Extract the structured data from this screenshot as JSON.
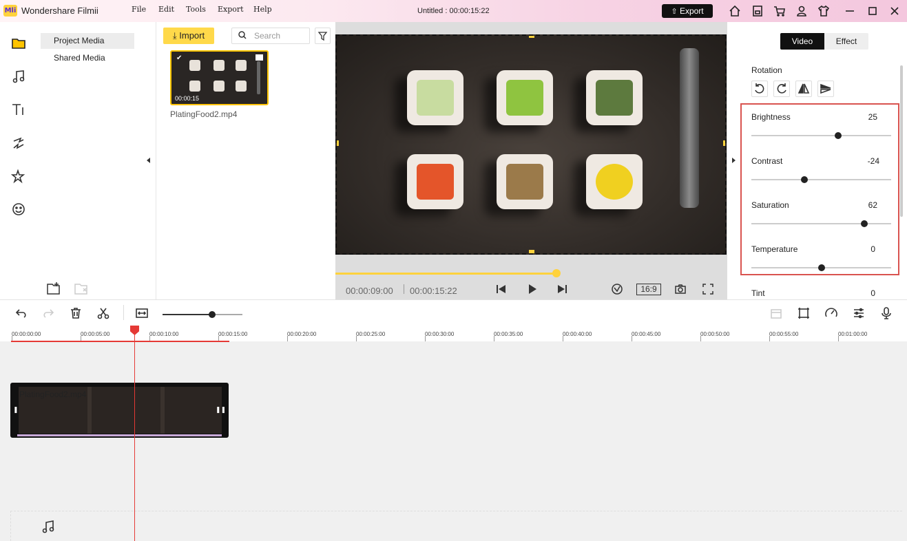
{
  "titlebar": {
    "logo": "Mli",
    "app_name": "Wondershare Filmii",
    "menu": [
      "File",
      "Edit",
      "Tools",
      "Export",
      "Help"
    ],
    "doc_title": "Untitled :",
    "doc_time": "00:00:15:22",
    "export_label": "Export"
  },
  "left_nav": {
    "project_media": "Project Media",
    "shared_media": "Shared Media"
  },
  "media": {
    "import_label": "Import",
    "search_placeholder": "Search",
    "clip_duration": "00:00:15",
    "clip_name": "PlatingFood2.mp4"
  },
  "player": {
    "current_time": "00:00:09:00",
    "total_time": "00:00:15:22",
    "ratio": "16:9",
    "progress": 0.56
  },
  "panel": {
    "tabs": [
      "Video",
      "Effect"
    ],
    "rotation_label": "Rotation",
    "sliders": [
      {
        "label": "Brightness",
        "value": "25",
        "level": 0.62
      },
      {
        "label": "Contrast",
        "value": "-24",
        "level": 0.38
      },
      {
        "label": "Saturation",
        "value": "62",
        "level": 0.81
      },
      {
        "label": "Temperature",
        "value": "0",
        "level": 0.5
      }
    ],
    "tint_label": "Tint",
    "tint_value": "0"
  },
  "timeline": {
    "ticks": [
      "00:00:00:00",
      "00:00:05:00",
      "00:00:10:00",
      "00:00:15:00",
      "00:00:20:00",
      "00:00:25:00",
      "00:00:30:00",
      "00:00:35:00",
      "00:00:40:00",
      "00:00:45:00",
      "00:00:50:00",
      "00:00:55:00",
      "00:01:00:00"
    ],
    "clip_label": "PlatingFood2.mp4"
  },
  "colors": {
    "accent": "#ffd23c",
    "export_bg": "#111111",
    "highlight_border": "#d9534f",
    "playhead": "#e53935"
  }
}
